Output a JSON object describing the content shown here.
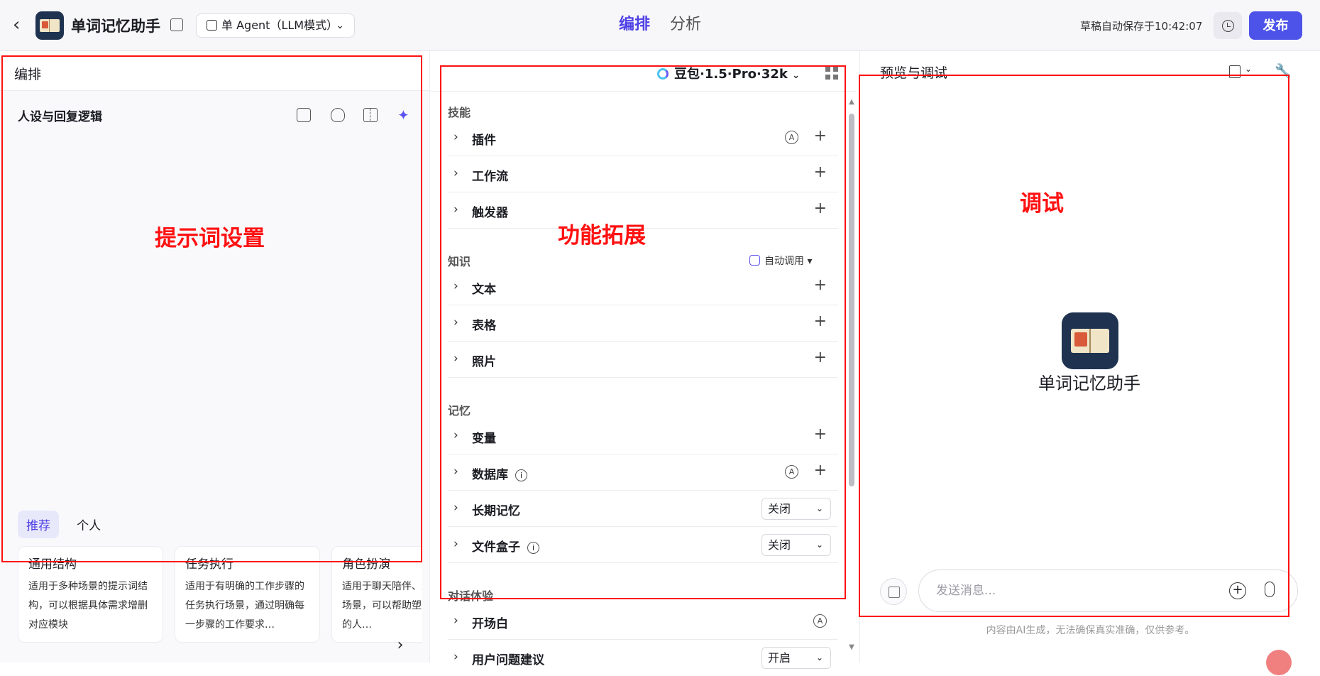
{
  "header": {
    "app_title": "单词记忆助手",
    "agent_mode": "单 Agent（LLM模式）",
    "tabs": [
      "编排",
      "分析"
    ],
    "autosave": "草稿自动保存于10:42:07",
    "publish": "发布"
  },
  "left": {
    "head": "编排",
    "persona_title": "人设与回复逻辑",
    "sub_tabs": [
      "推荐",
      "个人"
    ],
    "cards": [
      {
        "title": "通用结构",
        "desc": "适用于多种场景的提示词结构，可以根据具体需求增删对应模块"
      },
      {
        "title": "任务执行",
        "desc": "适用于有明确的工作步骤的任务执行场景，通过明确每一步骤的工作要求…"
      },
      {
        "title": "角色扮演",
        "desc": "适用于聊天陪伴、互动娱乐场景，可以帮助塑造个性化的人…"
      }
    ]
  },
  "middle": {
    "model": "豆包·1.5·Pro·32k",
    "sections": {
      "skills": "技能",
      "knowledge": "知识",
      "memory": "记忆",
      "dialog": "对话体验"
    },
    "auto_call": "自动调用",
    "rows": {
      "plugin": "插件",
      "workflow": "工作流",
      "trigger": "触发器",
      "text": "文本",
      "table": "表格",
      "photo": "照片",
      "variable": "变量",
      "database": "数据库",
      "long_memory": "长期记忆",
      "filebox": "文件盒子",
      "opening": "开场白",
      "suggest": "用户问题建议"
    },
    "select_off": "关闭",
    "select_on": "开启"
  },
  "right": {
    "head": "预览与调试",
    "bot_name": "单词记忆助手",
    "input_placeholder": "发送消息...",
    "disclaimer": "内容由AI生成，无法确保真实准确，仅供参考。"
  },
  "annotations": {
    "prompt": "提示词设置",
    "features": "功能拓展",
    "debug": "调试"
  },
  "colors": {
    "accent": "#4d53e8",
    "annotation": "#ff1111"
  }
}
